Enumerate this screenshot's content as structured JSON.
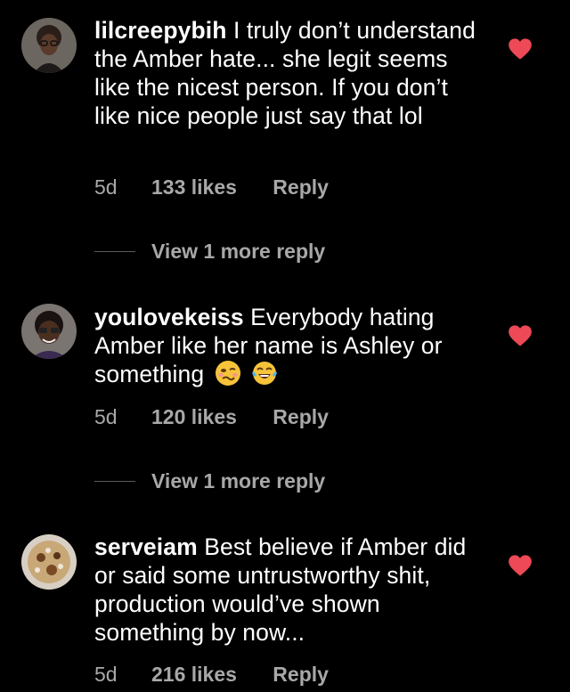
{
  "colors": {
    "background": "#000000",
    "text": "#ffffff",
    "secondary_text": "#a8a8a8",
    "heart": "#ed4956"
  },
  "comments": [
    {
      "username": "lilcreepybih",
      "text": "I truly don’t understand the Amber hate... she legit seems like the nicest person. If you don’t like nice people just say that lol",
      "time": "5d",
      "likes": "133 likes",
      "reply_label": "Reply",
      "liked": true,
      "more_replies": "View 1 more reply"
    },
    {
      "username": "youlovekeiss",
      "text": "Everybody hating Amber like her name is Ashley or something",
      "emojis": [
        "woozy-face-emoji",
        "face-with-tears-of-joy-emoji"
      ],
      "time": "5d",
      "likes": "120 likes",
      "reply_label": "Reply",
      "liked": true,
      "more_replies": "View 1 more reply"
    },
    {
      "username": "serveiam",
      "text": "Best believe if Amber did or said some untrustworthy shit, production would’ve shown something by now...",
      "time": "5d",
      "likes": "216 likes",
      "reply_label": "Reply",
      "liked": true
    }
  ]
}
